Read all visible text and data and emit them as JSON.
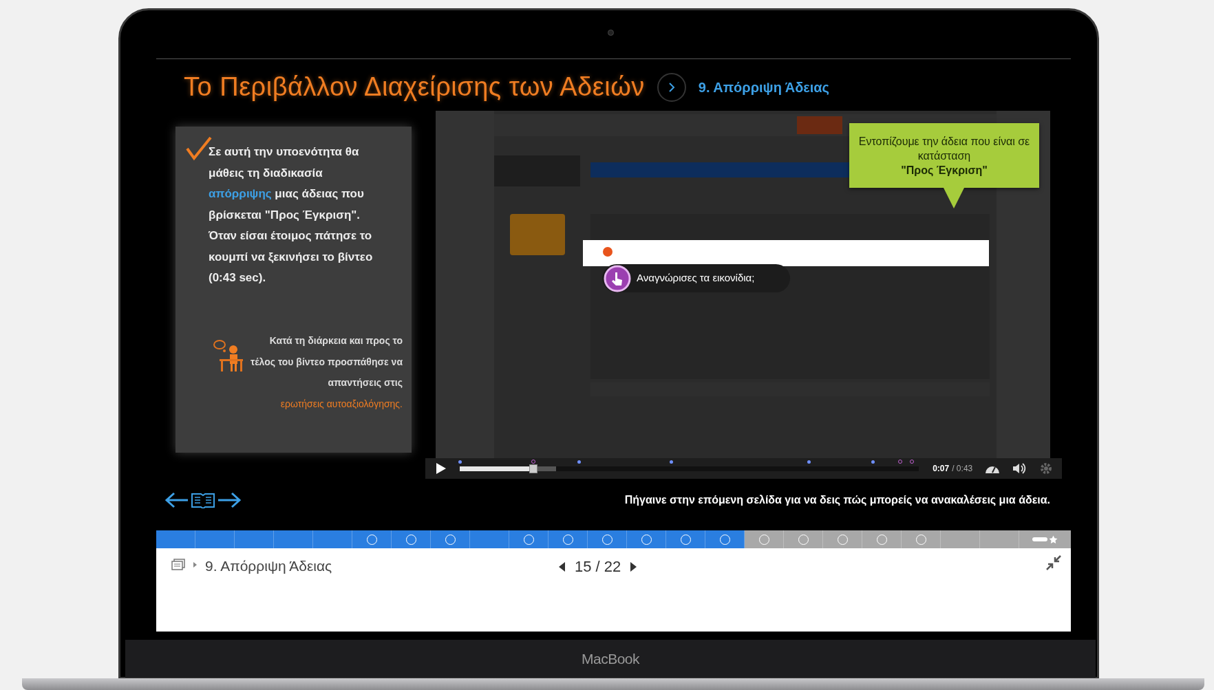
{
  "header": {
    "title": "Το Περιβάλλον Διαχείρισης των Αδειών",
    "section": "9. Απόρριψη Άδειας"
  },
  "intro": {
    "checked": true,
    "parts": [
      {
        "text": "Σε αυτή την υποενότητα θα μάθεις τη διαδικασία ",
        "kind": "plain"
      },
      {
        "text": "απόρριψης",
        "kind": "highlight"
      },
      {
        "text": " μιας άδειας που βρίσκεται  \"Προς Έγκριση\". Όταν είσαι έτοιμος πάτησε το κουμπί να ξεκινήσει το βίντεο (0:43 sec).",
        "kind": "plain"
      }
    ]
  },
  "tip": {
    "parts": [
      {
        "text": "Κατά τη διάρκεια και προς το τέλος του βίντεο προσπάθησε να απαντήσεις στις ",
        "kind": "plain"
      },
      {
        "text": "ερωτήσεις αυτοαξιολόγησης.",
        "kind": "accent"
      }
    ]
  },
  "video": {
    "callout": "Εντοπίζουμε την άδεια που είναι σε κατάσταση",
    "callout_emphasis": "\"Προς Έγκριση\"",
    "question": "Αναγνώρισες τα εικονίδια;",
    "playing": false,
    "level": 0.16,
    "time": "0:07",
    "duration": "/ 0:43"
  },
  "next_hint": "Πήγαινε στην επόμενη σελίδα για να δεις πώς μπορείς να ανακαλέσεις μια άδεια.",
  "pages": [
    {
      "visited": true,
      "quiz": false
    },
    {
      "visited": true,
      "quiz": false
    },
    {
      "visited": true,
      "quiz": false
    },
    {
      "visited": true,
      "quiz": false
    },
    {
      "visited": true,
      "quiz": false
    },
    {
      "visited": true,
      "quiz": true
    },
    {
      "visited": true,
      "quiz": true
    },
    {
      "visited": true,
      "quiz": true
    },
    {
      "visited": true,
      "quiz": false
    },
    {
      "visited": true,
      "quiz": true
    },
    {
      "visited": true,
      "quiz": true
    },
    {
      "visited": true,
      "quiz": true
    },
    {
      "visited": true,
      "quiz": true
    },
    {
      "visited": true,
      "quiz": true
    },
    {
      "visited": true,
      "quiz": true
    },
    {
      "visited": false,
      "quiz": true
    },
    {
      "visited": false,
      "quiz": true
    },
    {
      "visited": false,
      "quiz": true
    },
    {
      "visited": false,
      "quiz": true
    },
    {
      "visited": false,
      "quiz": true
    },
    {
      "visited": false,
      "quiz": false
    },
    {
      "visited": false,
      "quiz": false
    }
  ],
  "footer": {
    "breadcrumb": "9. Απόρριψη Άδειας",
    "page": "15 / 22"
  },
  "device_label": "MacBook"
}
